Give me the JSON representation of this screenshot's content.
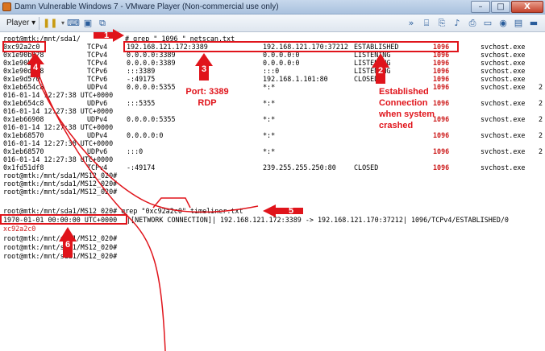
{
  "window": {
    "title": "Damn Vulnerable Windows 7 - VMware Player (Non-commercial use only)",
    "minimize_label": "–",
    "maximize_label": "□",
    "close_label": "X"
  },
  "toolbar": {
    "player_menu": "Player ▾",
    "icons": [
      "pause-icon",
      "send-ctrl-alt-del-icon",
      "unity-icon",
      "fullscreen-icon",
      "device-icons"
    ]
  },
  "terminal": {
    "cmd1": {
      "prompt": "root@mtk:/mnt/sda1/",
      "command": "# grep \" 1096 \" netscan.txt"
    },
    "rows": [
      {
        "offset": "0xc92a2c0",
        "proto": "TCPv4",
        "local": "192.168.121.172:3389",
        "foreign": "192.168.121.170:37212",
        "state": "ESTABLISHED",
        "pid": "1096",
        "owner": "svchost.exe",
        "extra": ""
      },
      {
        "offset": "0x1e90b3?8",
        "proto": "TCPv4",
        "local": "0.0.0.0:3389",
        "foreign": "0.0.0.0:0",
        "state": "LISTENING",
        "pid": "1096",
        "owner": "svchost.exe",
        "extra": ""
      },
      {
        "offset": "0x1e90b?",
        "proto": "TCPv4",
        "local": "0.0.0.0:3389",
        "foreign": "0.0.0.0:0",
        "state": "LISTENING",
        "pid": "1096",
        "owner": "svchost.exe",
        "extra": ""
      },
      {
        "offset": "0x1e90d??8",
        "proto": "TCPv6",
        "local": ":::3389",
        "foreign": ":::0",
        "state": "LISTENING",
        "pid": "1096",
        "owner": "svchost.exe",
        "extra": ""
      },
      {
        "offset": "0x1e9d5?0",
        "proto": "TCPv6",
        "local": "-:49175",
        "foreign": "192.168.1.101:80",
        "state": "CLOSED",
        "pid": "1096",
        "owner": "svchost.exe",
        "extra": ""
      },
      {
        "offset": "0x1eb654c8",
        "proto": "UDPv4",
        "local": "0.0.0.0:5355",
        "foreign": "*:*",
        "state": "",
        "pid": "1096",
        "owner": "svchost.exe",
        "extra": "2"
      }
    ],
    "row6_cont": "016-01-14 12:27:38 UTC+0000",
    "rows_b": [
      {
        "offset": "0x1eb654c8",
        "proto": "UDPv6",
        "local": ":::5355",
        "foreign": "*:*",
        "pid": "1096",
        "owner": "svchost.exe",
        "extra": "2",
        "cont": "016-01-14 12:27:38 UTC+0000"
      },
      {
        "offset": "0x1eb66908",
        "proto": "UDPv4",
        "local": "0.0.0.0:5355",
        "foreign": "*:*",
        "pid": "1096",
        "owner": "svchost.exe",
        "extra": "2",
        "cont": "016-01-14 12:27:38 UTC+0000"
      },
      {
        "offset": "0x1eb68570",
        "proto": "UDPv4",
        "local": "0.0.0.0:0",
        "foreign": "*:*",
        "pid": "1096",
        "owner": "svchost.exe",
        "extra": "2",
        "cont": "016-01-14 12:27:38 UTC+0000"
      },
      {
        "offset": "0x1eb68570",
        "proto": "UDPv6",
        "local": ":::0",
        "foreign": "*:*",
        "pid": "1096",
        "owner": "svchost.exe",
        "extra": "2",
        "cont": "016-01-14 12:27:38 UTC+0000"
      }
    ],
    "last_row": {
      "offset": "0x1fd51df8",
      "proto": "TCPv4",
      "local": "-:49174",
      "foreign": "239.255.255.250:80",
      "state": "CLOSED",
      "pid": "1096",
      "owner": "svchost.exe"
    },
    "prompts": [
      "root@mtk:/mnt/sda1/MS12_020#",
      "root@mtk:/mnt/sda1/MS12_020#",
      "root@mtk:/mnt/sda1/MS12_020#"
    ],
    "cmd2": "root@mtk:/mnt/sda1/MS12_020# grep \"0xc92a2c0\" timeliner.txt",
    "timeline": {
      "timestamp": "1970-01-01 00:00:00 UTC+0000",
      "rest": "|[NETWORK CONNECTION]| 192.168.121.172:3389 -> 192.168.121.170:37212| 1096/TCPv4/ESTABLISHED/0",
      "wrap": "xc92a2c0"
    },
    "end_prompts": [
      "root@mtk:/mnt/sda1/MS12_020#",
      "root@mtk:/mnt/sda1/MS12_020#",
      "root@mtk:/mnt/sda1/MS12_020#"
    ]
  },
  "annotations": {
    "n1": "1",
    "n2": "2",
    "n3": "3",
    "n4": "4",
    "n5": "5",
    "n6": "6",
    "port_line1": "Port: 3389",
    "port_line2": "RDP",
    "est_lines": [
      "Established",
      "Connection",
      "when system",
      "crashed"
    ]
  },
  "colors": {
    "annotation": "#e0141b",
    "pid": "#cc1a1a",
    "titlebar": "#b8cbe3"
  }
}
